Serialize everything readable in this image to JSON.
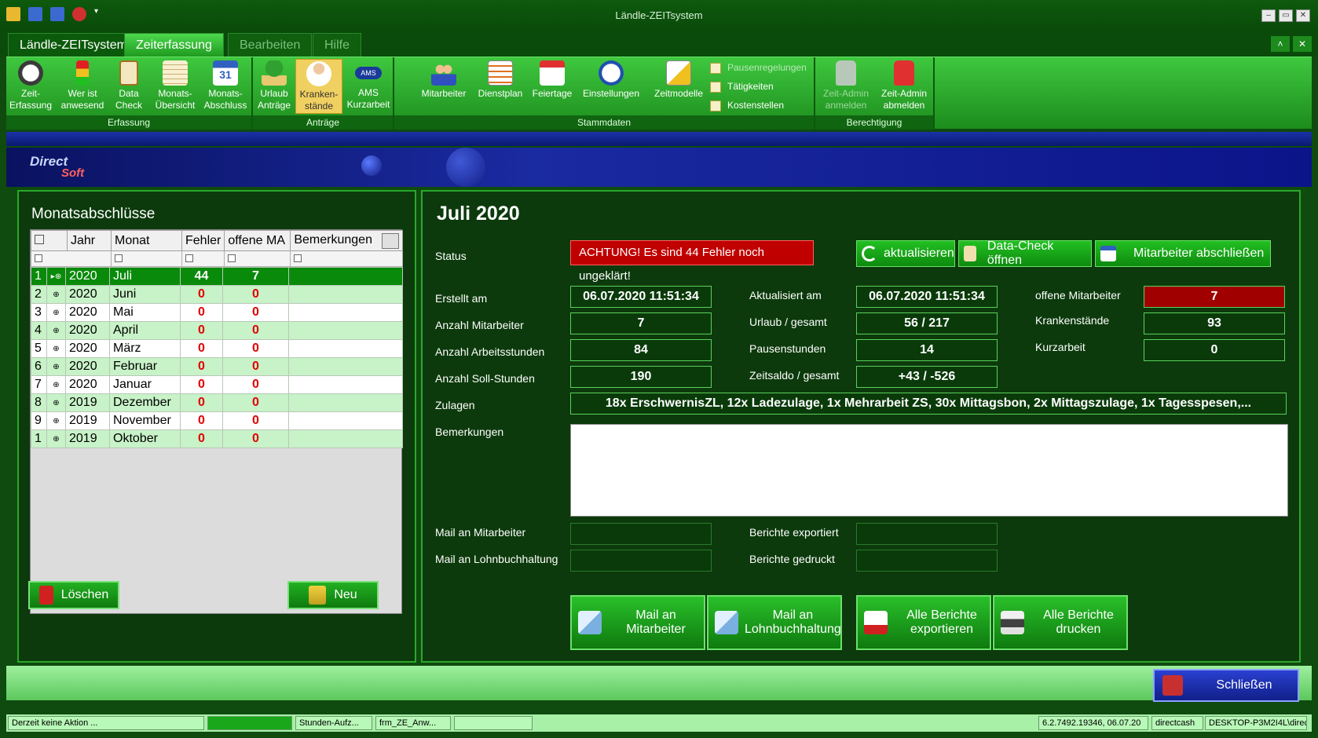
{
  "window": {
    "title": "Ländle-ZEITsystem"
  },
  "tabs": [
    {
      "label": "Ländle-ZEITsystem"
    },
    {
      "label": "Zeiterfassung"
    },
    {
      "label": "Bearbeiten"
    },
    {
      "label": "Hilfe"
    }
  ],
  "ribbon": {
    "groups": [
      {
        "label": "Erfassung"
      },
      {
        "label": "Anträge"
      },
      {
        "label": "Stammdaten"
      },
      {
        "label": "Berechtigung"
      }
    ],
    "buttons": {
      "zeit_erfassung": "Zeit-\nErfassung",
      "wer_ist_anwesend": "Wer ist\nanwesend",
      "data_check": "Data\nCheck",
      "monats_uebersicht": "Monats-\nÜbersicht",
      "monats_abschluss": "Monats-\nAbschluss",
      "urlaub_antraege": "Urlaub\nAnträge",
      "krankenstaende": "Kranken-\nstände",
      "ams_kurzarbeit": "AMS\nKurzarbeit",
      "mitarbeiter": "Mitarbeiter",
      "dienstplan": "Dienstplan",
      "feiertage": "Feiertage",
      "einstellungen": "Einstellungen",
      "zeitmodelle": "Zeitmodelle",
      "pausenregelungen": "Pausenregelungen",
      "taetigkeiten": "Tätigkeiten",
      "kostenstellen": "Kostenstellen",
      "zeit_admin_anmelden": "Zeit-Admin\nanmelden",
      "zeit_admin_abmelden": "Zeit-Admin\nabmelden"
    },
    "ams_icon_text": "AMS"
  },
  "logo": {
    "line1": "Direct",
    "line2": "Soft"
  },
  "left": {
    "title": "Monatsabschlüsse",
    "columns": [
      "Jahr",
      "Monat",
      "Fehler",
      "offene MA",
      "Bemerkungen"
    ],
    "rows": [
      {
        "rn": "1",
        "jahr": "2020",
        "monat": "Juli",
        "fehler": "44",
        "offene": "7",
        "bem": ""
      },
      {
        "rn": "2",
        "jahr": "2020",
        "monat": "Juni",
        "fehler": "0",
        "offene": "0",
        "bem": ""
      },
      {
        "rn": "3",
        "jahr": "2020",
        "monat": "Mai",
        "fehler": "0",
        "offene": "0",
        "bem": ""
      },
      {
        "rn": "4",
        "jahr": "2020",
        "monat": "April",
        "fehler": "0",
        "offene": "0",
        "bem": ""
      },
      {
        "rn": "5",
        "jahr": "2020",
        "monat": "März",
        "fehler": "0",
        "offene": "0",
        "bem": ""
      },
      {
        "rn": "6",
        "jahr": "2020",
        "monat": "Februar",
        "fehler": "0",
        "offene": "0",
        "bem": ""
      },
      {
        "rn": "7",
        "jahr": "2020",
        "monat": "Januar",
        "fehler": "0",
        "offene": "0",
        "bem": ""
      },
      {
        "rn": "8",
        "jahr": "2019",
        "monat": "Dezember",
        "fehler": "0",
        "offene": "0",
        "bem": ""
      },
      {
        "rn": "9",
        "jahr": "2019",
        "monat": "November",
        "fehler": "0",
        "offene": "0",
        "bem": ""
      },
      {
        "rn": "1",
        "jahr": "2019",
        "monat": "Oktober",
        "fehler": "0",
        "offene": "0",
        "bem": ""
      }
    ],
    "delete_label": "Löschen",
    "new_label": "Neu"
  },
  "right": {
    "title": "Juli 2020",
    "status_label": "Status",
    "status_text": "ACHTUNG! Es sind 44 Fehler noch ungeklärt!",
    "btn_refresh": "aktualisieren",
    "btn_datacheck": "Data-Check öffnen",
    "btn_close_employees": "Mitarbeiter abschließen",
    "erstellt_label": "Erstellt am",
    "erstellt_val": "06.07.2020 11:51:34",
    "aktualisiert_label": "Aktualisiert am",
    "aktualisiert_val": "06.07.2020 11:51:34",
    "offene_label": "offene Mitarbeiter",
    "offene_val": "7",
    "anz_ma_label": "Anzahl Mitarbeiter",
    "anz_ma_val": "7",
    "urlaub_label": "Urlaub / gesamt",
    "urlaub_val": "56 / 217",
    "kranken_label": "Krankenstände",
    "kranken_val": "93",
    "arbeitsstd_label": "Anzahl Arbeitsstunden",
    "arbeitsstd_val": "84",
    "pausen_label": "Pausenstunden",
    "pausen_val": "14",
    "kurzarbeit_label": "Kurzarbeit",
    "kurzarbeit_val": "0",
    "soll_label": "Anzahl Soll-Stunden",
    "soll_val": "190",
    "saldo_label": "Zeitsaldo / gesamt",
    "saldo_val": "+43 / -526",
    "zulagen_label": "Zulagen",
    "zulagen_val": "18x ErschwernisZL,  12x Ladezulage,  1x Mehrarbeit ZS,  30x Mittagsbon,  2x Mittagszulage,  1x Tagesspesen,...",
    "bemerkungen_label": "Bemerkungen",
    "mail_ma_label": "Mail an Mitarbeiter",
    "mail_lohn_label": "Mail an Lohnbuchhaltung",
    "exportiert_label": "Berichte exportiert",
    "gedruckt_label": "Berichte gedruckt",
    "btn_mail_ma": "Mail an\nMitarbeiter",
    "btn_mail_lohn": "Mail an\nLohnbuchhaltung",
    "btn_export": "Alle Berichte\nexportieren",
    "btn_print": "Alle Berichte\ndrucken"
  },
  "close_label": "Schließen",
  "statusbar": {
    "action": "Derzeit keine Aktion ...",
    "task1": "Stunden-Aufz...",
    "task2": "frm_ZE_Anw...",
    "version": "6.2.7492.19346, 06.07.20",
    "user": "directcash",
    "machine": "DESKTOP-P3M2I4L\\direc"
  }
}
